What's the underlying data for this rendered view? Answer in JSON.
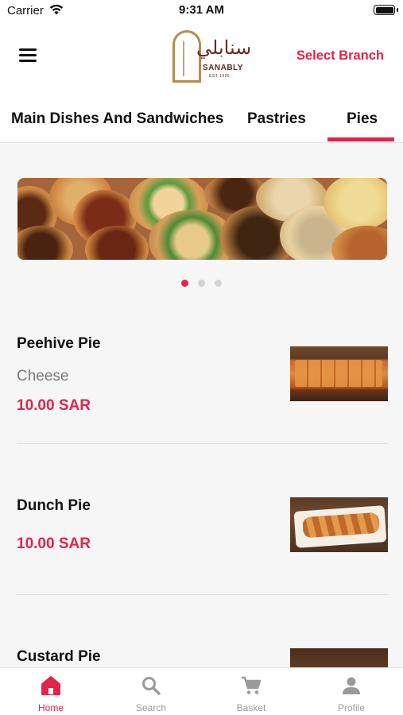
{
  "status_bar": {
    "carrier": "Carrier",
    "time": "9:31 AM"
  },
  "header": {
    "logo": {
      "script": "سنابلي",
      "name": "SANABLY",
      "est": "· EST 1995 ·"
    },
    "select_branch": "Select Branch"
  },
  "tabs": [
    {
      "label": "Main Dishes And Sandwiches",
      "active": false
    },
    {
      "label": "Pastries",
      "active": false
    },
    {
      "label": "Pies",
      "active": true
    }
  ],
  "carousel": {
    "page_count": 3,
    "active_index": 0
  },
  "products": [
    {
      "name": "Peehive Pie",
      "description": "Cheese",
      "price": "10.00 SAR"
    },
    {
      "name": "Dunch Pie",
      "description": "",
      "price": "10.00 SAR"
    },
    {
      "name": "Custard Pie",
      "description": "",
      "price": ""
    }
  ],
  "bottom_nav": [
    {
      "label": "Home",
      "icon": "home-icon",
      "active": true
    },
    {
      "label": "Search",
      "icon": "search-icon",
      "active": false
    },
    {
      "label": "Basket",
      "icon": "cart-icon",
      "active": false
    },
    {
      "label": "Profile",
      "icon": "profile-icon",
      "active": false
    }
  ],
  "colors": {
    "accent": "#e5224b",
    "logo_gold": "#b78c4e",
    "logo_brown": "#6b2b1f"
  }
}
